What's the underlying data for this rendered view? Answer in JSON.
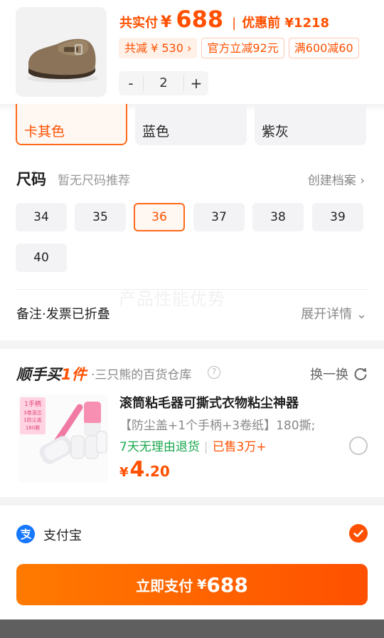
{
  "order": {
    "total_label": "共实付",
    "currency": "¥",
    "total_amount": "688",
    "before_discount_label": "优惠前 ¥1218",
    "chips": [
      "共减 ¥ 530 ›",
      "官方立减92元",
      "满600减60"
    ],
    "quantity": {
      "minus": "-",
      "value": "2",
      "plus": "+"
    }
  },
  "colors": {
    "options": [
      "卡其色",
      "蓝色",
      "紫灰"
    ],
    "selected": "卡其色"
  },
  "size": {
    "title": "尺码",
    "subtitle": "暂无尺码推荐",
    "link": "创建档案 ›",
    "options": [
      "34",
      "35",
      "36",
      "37",
      "38",
      "39",
      "40"
    ],
    "selected": "36"
  },
  "notes": {
    "watermark": "产品性能优势",
    "label": "备注·发票已折叠",
    "expand": "展开详情 ⌄"
  },
  "bundle": {
    "logo_prefix": "顺手买",
    "logo_highlight": "1件",
    "dot": "·",
    "store": "三只熊的百货仓库",
    "help": "?",
    "swap": "换一换",
    "product": {
      "title": "滚筒粘毛器可撕式衣物粘尘神器",
      "desc": "【防尘盖+1个手柄+3卷纸】180撕;",
      "tag_return": "7天无理由退货",
      "tag_sold": "已售3万+",
      "currency": "¥",
      "price_int": "4",
      "price_dec": ".20",
      "img_tags": [
        "1手柄",
        "3卷滚芯",
        "1防尘盖",
        "180撕"
      ]
    }
  },
  "payment": {
    "method": "支付宝",
    "button_label": "立即支付",
    "button_currency": "¥",
    "button_amount": "688"
  },
  "theme": {
    "accent": "#ff5000",
    "green": "#1aa84d",
    "alipay_blue": "#1677ff"
  }
}
